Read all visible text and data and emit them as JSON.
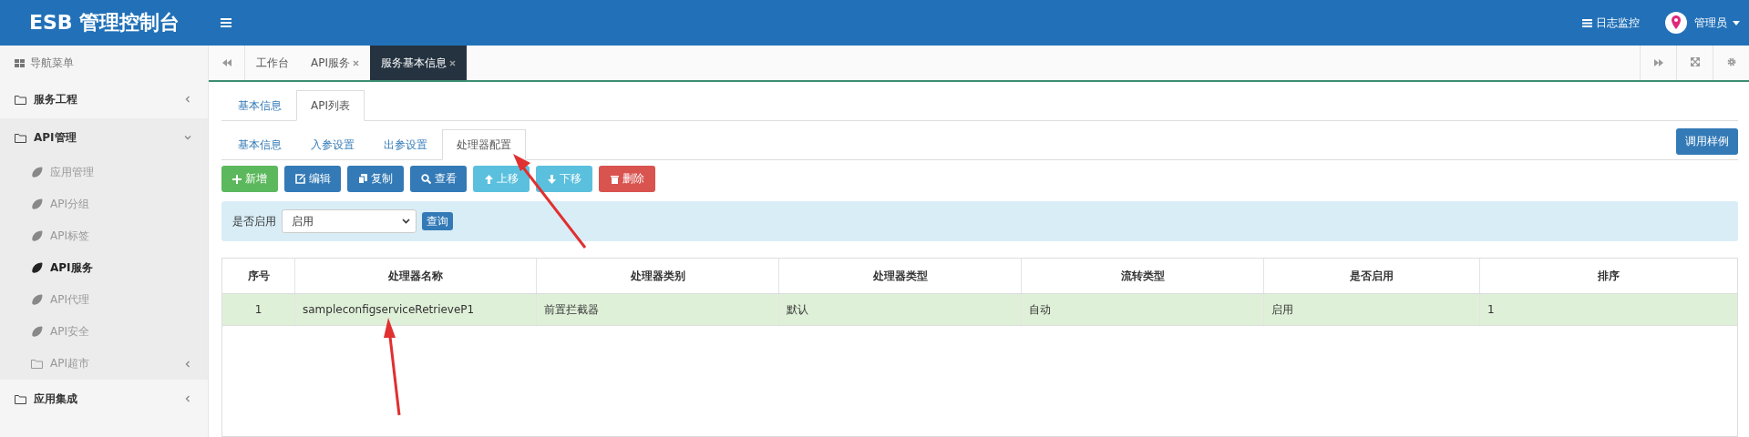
{
  "header": {
    "logo": "ESB 管理控制台",
    "log_monitor": "日志监控",
    "user": "管理员"
  },
  "sidebar": {
    "title": "导航菜单",
    "items": [
      {
        "label": "服务工程",
        "kind": "folder",
        "expanded": false
      },
      {
        "label": "API管理",
        "kind": "folder",
        "expanded": true,
        "children": [
          {
            "label": "应用管理",
            "kind": "leaf",
            "selected": false
          },
          {
            "label": "API分组",
            "kind": "leaf",
            "selected": false
          },
          {
            "label": "API标签",
            "kind": "leaf",
            "selected": false
          },
          {
            "label": "API服务",
            "kind": "leaf",
            "selected": true
          },
          {
            "label": "API代理",
            "kind": "leaf",
            "selected": false
          },
          {
            "label": "API安全",
            "kind": "leaf",
            "selected": false
          },
          {
            "label": "API超市",
            "kind": "folder",
            "expanded": false
          }
        ]
      },
      {
        "label": "应用集成",
        "kind": "folder",
        "expanded": false
      }
    ]
  },
  "page_tabs": [
    {
      "label": "工作台",
      "closable": false,
      "selected": false
    },
    {
      "label": "API服务",
      "closable": true,
      "selected": false
    },
    {
      "label": "服务基本信息",
      "closable": true,
      "selected": true
    }
  ],
  "tabs": [
    {
      "label": "基本信息",
      "selected": false
    },
    {
      "label": "API列表",
      "selected": true
    }
  ],
  "sub_tabs": [
    {
      "label": "基本信息",
      "selected": false
    },
    {
      "label": "入参设置",
      "selected": false
    },
    {
      "label": "出参设置",
      "selected": false
    },
    {
      "label": "处理器配置",
      "selected": true
    }
  ],
  "sample_button": "调用样例",
  "toolbar": [
    {
      "label": "新增",
      "kind": "add"
    },
    {
      "label": "编辑",
      "kind": "edit"
    },
    {
      "label": "复制",
      "kind": "copy"
    },
    {
      "label": "查看",
      "kind": "view"
    },
    {
      "label": "上移",
      "kind": "up"
    },
    {
      "label": "下移",
      "kind": "down"
    },
    {
      "label": "删除",
      "kind": "delete"
    }
  ],
  "filter": {
    "label": "是否启用",
    "value": "启用",
    "button": "查询"
  },
  "table": {
    "columns": [
      "序号",
      "处理器名称",
      "处理器类别",
      "处理器类型",
      "流转类型",
      "是否启用",
      "排序"
    ],
    "rows": [
      {
        "selected": true,
        "cells": [
          "1",
          "sampleconfigserviceRetrieveP1",
          "前置拦截器",
          "默认",
          "自动",
          "启用",
          "1"
        ]
      }
    ]
  }
}
